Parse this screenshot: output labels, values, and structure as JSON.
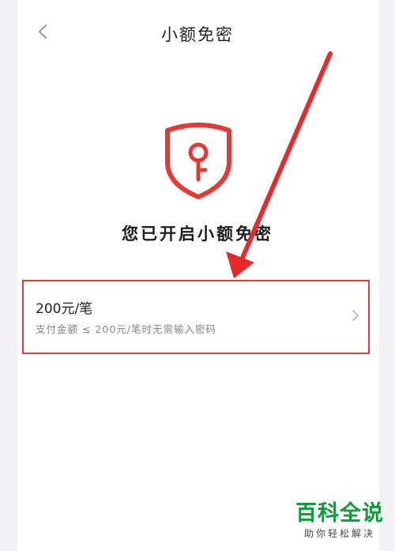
{
  "header": {
    "title": "小额免密"
  },
  "status": {
    "text": "您已开启小额免密"
  },
  "limit_row": {
    "amount": "200元/笔",
    "description": "支付金额 ≤ 200元/笔时无需输入密码"
  },
  "colors": {
    "accent_red": "#e53935",
    "watermark_green": "#0f9d3a"
  },
  "icons": [
    "back-arrow-icon",
    "shield-key-icon",
    "chevron-right-icon",
    "annotation-arrow"
  ],
  "watermark": {
    "title": "百科全说",
    "subtitle": "助你轻松解决"
  }
}
